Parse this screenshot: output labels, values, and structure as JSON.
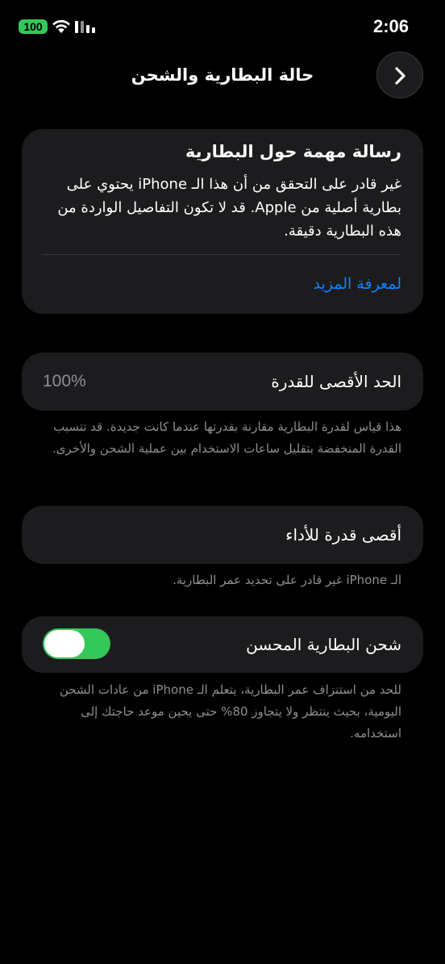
{
  "status_bar": {
    "battery_level": "100",
    "time": "2:06"
  },
  "nav": {
    "title": "حالة البطارية والشحن",
    "back_icon": "chevron-right-icon"
  },
  "important_message": {
    "title": "رسالة مهمة حول البطارية",
    "body": "غير قادر على التحقق من أن هذا الـ iPhone يحتوي على بطارية أصلية من Apple. قد لا تكون التفاصيل الواردة من هذه البطارية دقيقة.",
    "link": "لمعرفة المزيد"
  },
  "maximum_capacity": {
    "label": "الحد الأقصى للقدرة",
    "value": "100%",
    "footnote": "هذا قياس لقدرة البطارية مقارنة بقدرتها عندما كانت جديدة. قد تتسبب القدرة المنخفضة بتقليل ساعات الاستخدام بين عملية الشحن والأخرى."
  },
  "peak_performance": {
    "label": "أقصى قدرة للأداء",
    "footnote": "الـ iPhone غير قادر على تحديد عمر البطارية."
  },
  "optimized_charging": {
    "label": "شحن البطارية المحسن",
    "enabled": true,
    "footnote": "للحد من استنزاف عمر البطارية، يتعلم الـ iPhone من عادات الشحن اليومية، بحيث ينتظر ولا يتجاوز 80% حتى يحين موعد حاجتك إلى استخدامه."
  },
  "colors": {
    "background": "#000000",
    "card": "#1c1c1e",
    "accent_link": "#0a84ff",
    "toggle_on": "#34c759",
    "secondary_text": "#8e8e93"
  }
}
